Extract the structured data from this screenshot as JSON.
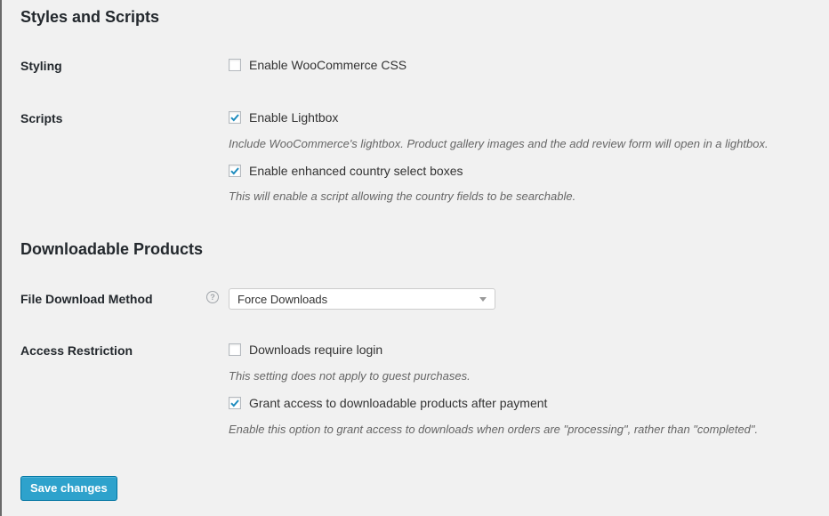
{
  "sections": {
    "styles_scripts": {
      "title": "Styles and Scripts"
    },
    "downloadable": {
      "title": "Downloadable Products"
    }
  },
  "styling": {
    "label": "Styling",
    "enable_css": {
      "label": "Enable WooCommerce CSS",
      "checked": false
    }
  },
  "scripts": {
    "label": "Scripts",
    "lightbox": {
      "label": "Enable Lightbox",
      "checked": true,
      "description": "Include WooCommerce's lightbox. Product gallery images and the add review form will open in a lightbox."
    },
    "country_select": {
      "label": "Enable enhanced country select boxes",
      "checked": true,
      "description": "This will enable a script allowing the country fields to be searchable."
    }
  },
  "file_download": {
    "label": "File Download Method",
    "help_icon": "question-mark-circle",
    "selected": "Force Downloads"
  },
  "access_restriction": {
    "label": "Access Restriction",
    "require_login": {
      "label": "Downloads require login",
      "checked": false,
      "description": "This setting does not apply to guest purchases."
    },
    "grant_access": {
      "label": "Grant access to downloadable products after payment",
      "checked": true,
      "description": "Enable this option to grant access to downloads when orders are \"processing\", rather than \"completed\"."
    }
  },
  "save_button": {
    "label": "Save changes"
  },
  "colors": {
    "accent": "#2ea2cc",
    "check": "#1e8cbe",
    "background": "#f1f1f1"
  }
}
